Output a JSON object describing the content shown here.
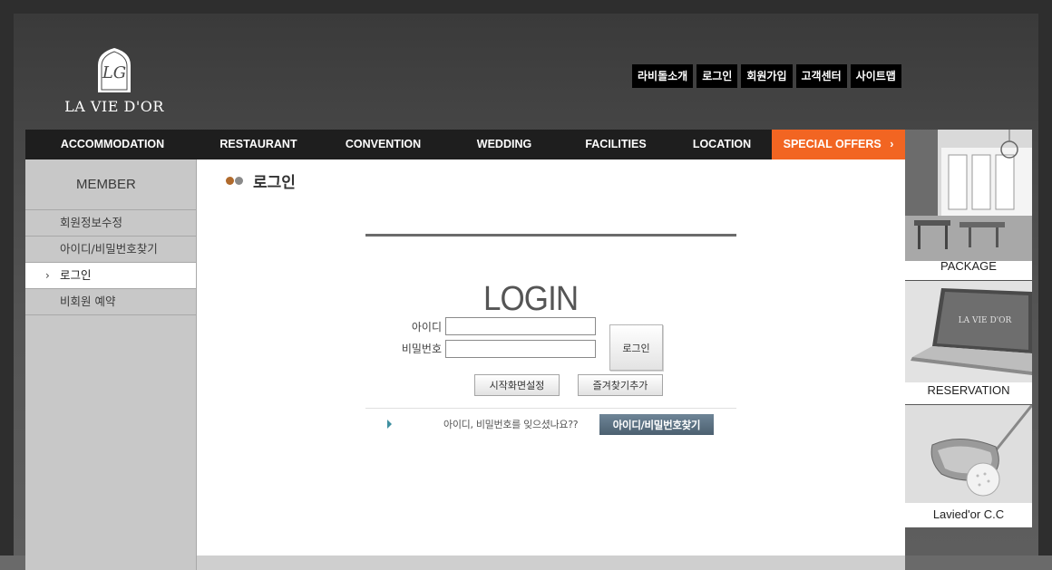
{
  "brand": {
    "name": "LA VIE D'OR"
  },
  "top_links": [
    "라비돌소개",
    "로그인",
    "회원가입",
    "고객센터",
    "사이트맵"
  ],
  "main_nav": [
    "ACCOMMODATION",
    "RESTAURANT",
    "CONVENTION",
    "WEDDING",
    "FACILITIES",
    "LOCATION",
    "SPECIAL OFFERS"
  ],
  "sidebar": {
    "title": "MEMBER",
    "items": [
      {
        "label": "회원정보수정",
        "active": false
      },
      {
        "label": "아이디/비밀번호찾기",
        "active": false
      },
      {
        "label": "로그인",
        "active": true
      },
      {
        "label": "비회원 예약",
        "active": false
      }
    ]
  },
  "page": {
    "title": "로그인"
  },
  "login": {
    "heading": "LOGIN",
    "id_label": "아이디",
    "password_label": "비밀번호",
    "id_value": "",
    "password_value": "",
    "submit_label": "로그인",
    "set_homepage_label": "시작화면설정",
    "add_favorite_label": "즐겨찾기추가",
    "forgot_text": "아이디, 비밀번호를 잊으셨나요??",
    "find_button_label": "아이디/비밀번호찾기"
  },
  "promos": [
    {
      "label": "PACKAGE",
      "icon": "restaurant-photo"
    },
    {
      "label": "RESERVATION",
      "icon": "laptop-photo"
    },
    {
      "label": "Lavied'or C.C",
      "icon": "golf-club-photo"
    }
  ],
  "colors": {
    "accent": "#f26522",
    "nav_bg": "#1e1e1e",
    "dot_brown": "#b06a2c",
    "dot_gray": "#8a8a8a",
    "find_button": "#5a6e7e"
  }
}
